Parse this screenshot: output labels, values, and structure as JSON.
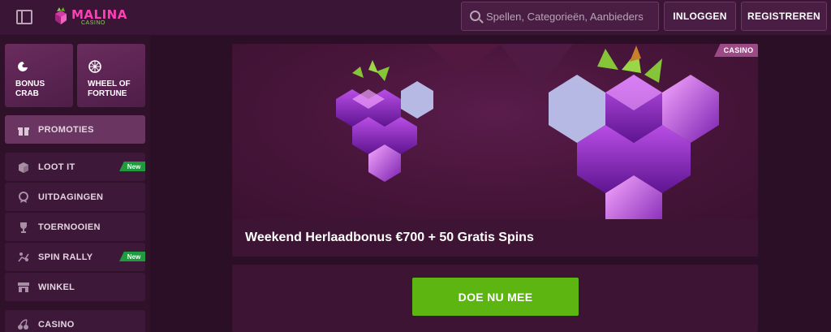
{
  "brand": {
    "name": "MALINA",
    "sub": "CASINO"
  },
  "search": {
    "placeholder": "Spellen, Categorieën, Aanbieders"
  },
  "header": {
    "login": "INLOGGEN",
    "register": "REGISTREREN"
  },
  "sidebar": {
    "tiles": [
      {
        "label": "BONUS\nCRAB",
        "icon": "crab-claw-icon"
      },
      {
        "label": "WHEEL OF\nFORTUNE",
        "icon": "wheel-icon"
      }
    ],
    "items": [
      {
        "label": "PROMOTIES",
        "icon": "gift-icon",
        "active": true
      },
      {
        "label": "LOOT IT",
        "icon": "loot-box-icon",
        "badge": "New"
      },
      {
        "label": "UITDAGINGEN",
        "icon": "medal-icon"
      },
      {
        "label": "TOERNOOIEN",
        "icon": "trophy-icon"
      },
      {
        "label": "SPIN RALLY",
        "icon": "rally-icon",
        "badge": "New"
      },
      {
        "label": "WINKEL",
        "icon": "shop-icon"
      },
      {
        "label": "CASINO",
        "icon": "cherry-icon"
      }
    ]
  },
  "promo": {
    "tag": "CASINO",
    "title": "Weekend Herlaadbonus €700 + 50 Gratis Spins",
    "cta": "DOE NU MEE"
  },
  "colors": {
    "accent_green": "#5cb511",
    "brand_pink": "#ff3fb4",
    "badge_green": "#1f9a3e"
  }
}
